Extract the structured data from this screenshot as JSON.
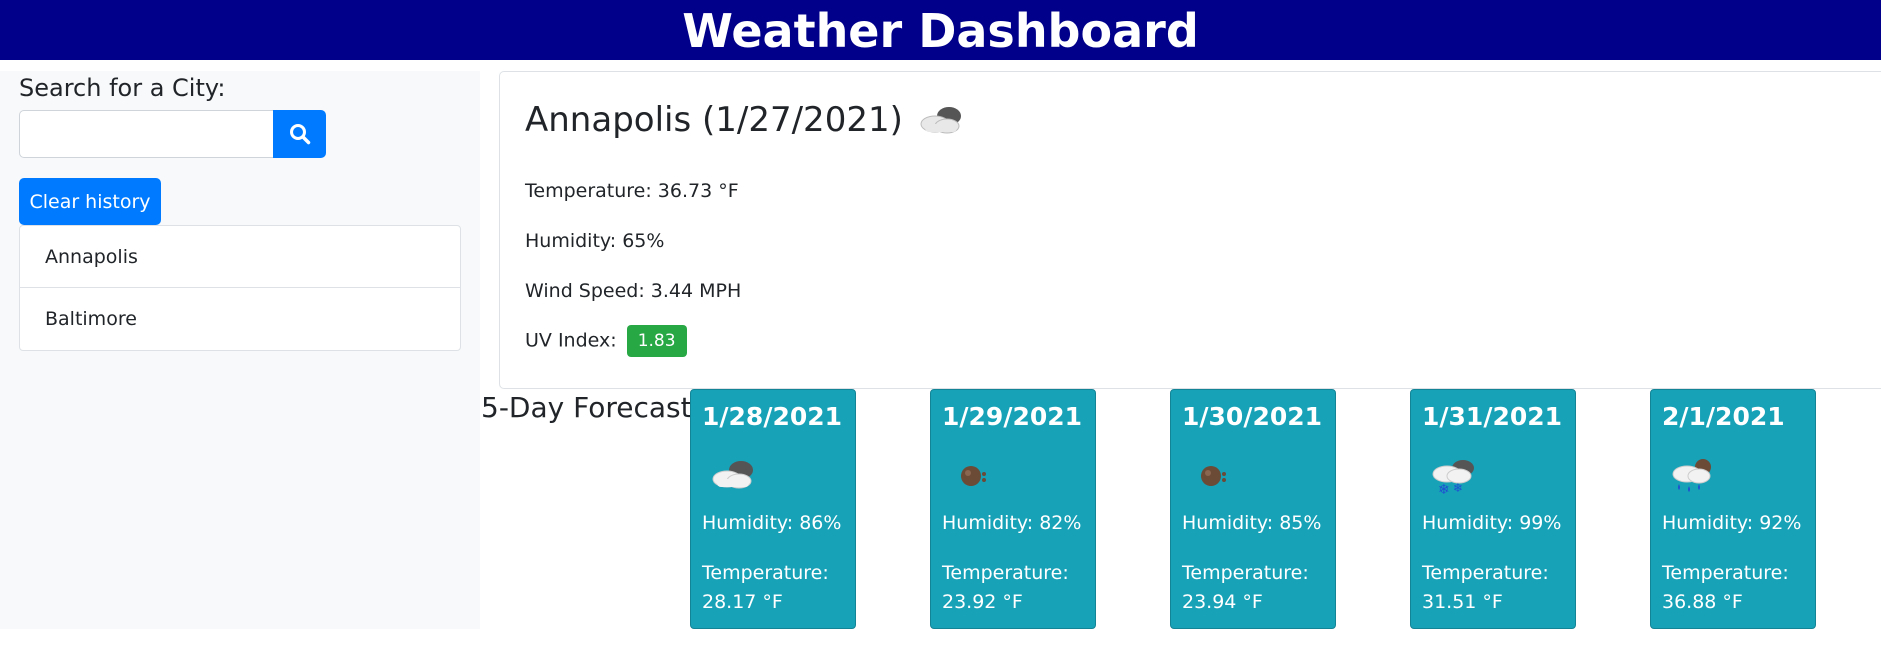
{
  "header": {
    "title": "Weather Dashboard"
  },
  "search": {
    "label": "Search for a City:",
    "value": "",
    "button_icon": "search-icon"
  },
  "history": {
    "clear_label": "Clear history",
    "items": [
      "Annapolis",
      "Baltimore"
    ]
  },
  "current": {
    "title": "Annapolis (1/27/2021)",
    "icon": "cloudy-icon",
    "temperature": "Temperature: 36.73 °F",
    "humidity": "Humidity: 65%",
    "wind": "Wind Speed: 3.44 MPH",
    "uv_label": "UV Index:",
    "uv_value": "1.83"
  },
  "forecast": {
    "label": "5-Day Forecast:",
    "temp_label": "Temperature:",
    "days": [
      {
        "date": "1/28/2021",
        "icon": "cloudy-icon",
        "humidity": "Humidity: 86%",
        "temp": "28.17 °F"
      },
      {
        "date": "1/29/2021",
        "icon": "moon-icon",
        "humidity": "Humidity: 82%",
        "temp": "23.92 °F"
      },
      {
        "date": "1/30/2021",
        "icon": "moon-icon",
        "humidity": "Humidity: 85%",
        "temp": "23.94 °F"
      },
      {
        "date": "1/31/2021",
        "icon": "snow-icon",
        "humidity": "Humidity: 99%",
        "temp": "31.51 °F"
      },
      {
        "date": "2/1/2021",
        "icon": "rain-icon",
        "humidity": "Humidity: 92%",
        "temp": "36.88 °F"
      }
    ]
  },
  "colors": {
    "header": "#00008b",
    "primary": "#007bff",
    "forecast_card": "#17a2b8",
    "uv_good": "#28a745"
  }
}
